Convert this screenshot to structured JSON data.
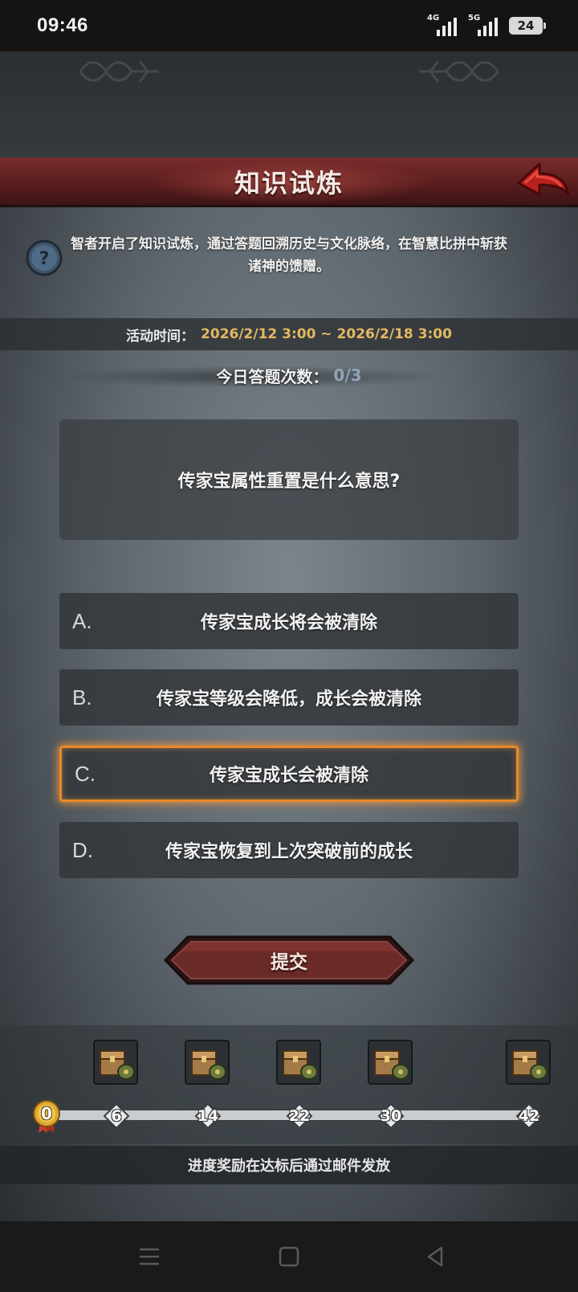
{
  "status_bar": {
    "time": "09:46",
    "network_1": "4G",
    "network_2": "5G",
    "battery": "24"
  },
  "header": {
    "title": "知识试炼",
    "back_icon": "back-arrow-icon"
  },
  "intro": {
    "icon": "help-icon",
    "text": "智者开启了知识试炼，通过答题回溯历史与文化脉络，在智慧比拼中斩获诸神的馈赠。"
  },
  "event_time": {
    "label": "活动时间：",
    "value": "2026/2/12 3:00 ~ 2026/2/18 3:00"
  },
  "daily_count": {
    "label": "今日答题次数：",
    "value": "0/3"
  },
  "question": {
    "text": "传家宝属性重置是什么意思?"
  },
  "options": [
    {
      "letter": "A.",
      "text": "传家宝成长将会被清除",
      "selected": false
    },
    {
      "letter": "B.",
      "text": "传家宝等级会降低，成长会被清除",
      "selected": false
    },
    {
      "letter": "C.",
      "text": "传家宝成长会被清除",
      "selected": true
    },
    {
      "letter": "D.",
      "text": "传家宝恢复到上次突破前的成长",
      "selected": false
    }
  ],
  "submit": {
    "label": "提交"
  },
  "progress": {
    "current": "0",
    "milestones": [
      "6",
      "14",
      "22",
      "30",
      "42"
    ],
    "reward_icon": "treasure-chest-icon",
    "notice": "进度奖励在达标后通过邮件发放"
  },
  "colors": {
    "accent_red": "#7a2c2c",
    "selected_border": "#e58a2c",
    "time_value": "#e5b860",
    "count_value": "#8fa4b8"
  },
  "nav": {
    "menu_icon": "menu-icon",
    "home_icon": "home-square-icon",
    "back_icon": "back-triangle-icon"
  }
}
